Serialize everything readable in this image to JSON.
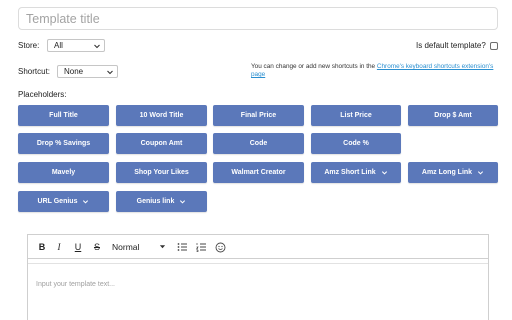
{
  "title_field": {
    "placeholder": "Template title",
    "value": ""
  },
  "store": {
    "label": "Store:",
    "value": "All"
  },
  "default_template": {
    "label": "Is default template?",
    "checked": false
  },
  "shortcut": {
    "label": "Shortcut:",
    "value": "None"
  },
  "shortcut_help": {
    "text": "You can change or add new shortcuts in the ",
    "link": "Chrome's keyboard shortcuts extension's page"
  },
  "placeholders": {
    "label": "Placeholders:",
    "buttons": [
      {
        "label": "Full Title",
        "dropdown": false
      },
      {
        "label": "10 Word Title",
        "dropdown": false
      },
      {
        "label": "Final Price",
        "dropdown": false
      },
      {
        "label": "List Price",
        "dropdown": false
      },
      {
        "label": "Drop $ Amt",
        "dropdown": false
      },
      {
        "label": "Drop % Savings",
        "dropdown": false
      },
      {
        "label": "Coupon Amt",
        "dropdown": false
      },
      {
        "label": "Code",
        "dropdown": false
      },
      {
        "label": "Code %",
        "dropdown": false
      },
      {
        "label": "Mavely",
        "dropdown": false
      },
      {
        "label": "Shop Your Likes",
        "dropdown": false
      },
      {
        "label": "Walmart Creator",
        "dropdown": false
      },
      {
        "label": "Amz Short Link",
        "dropdown": true
      },
      {
        "label": "Amz Long Link",
        "dropdown": true
      },
      {
        "label": "URL Genius",
        "dropdown": true
      },
      {
        "label": "Genius link",
        "dropdown": true
      }
    ]
  },
  "editor": {
    "toolbar": {
      "bold": "B",
      "italic": "I",
      "underline": "U",
      "strike": "S",
      "format": "Normal",
      "icons": [
        "bold-icon",
        "italic-icon",
        "underline-icon",
        "strikethrough-icon",
        "bullet-list-icon",
        "numbered-list-icon",
        "emoji-icon"
      ]
    },
    "placeholder": "Input your template text..."
  },
  "colors": {
    "button_bg": "#5b78ba",
    "link": "#2a8fd0"
  }
}
